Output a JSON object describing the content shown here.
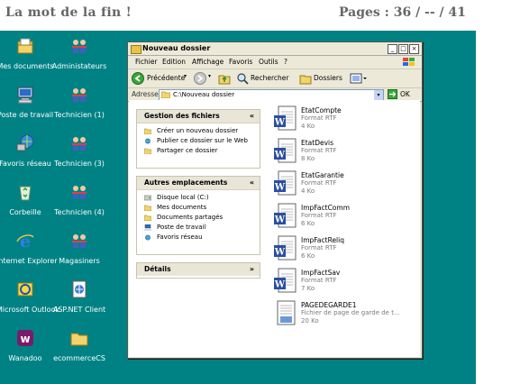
{
  "header": {
    "title": "La mot de la fin !",
    "pages": "Pages : 36 / -- / 41"
  },
  "desktop": {
    "background": "#008284",
    "icons": [
      {
        "label": "Mes documents",
        "icon": "my-documents-icon"
      },
      {
        "label": "Administateurs",
        "icon": "users-icon"
      },
      {
        "label": "Poste de travail",
        "icon": "my-computer-icon"
      },
      {
        "label": "Technicien (1)",
        "icon": "users-icon"
      },
      {
        "label": "Favoris réseau",
        "icon": "network-icon"
      },
      {
        "label": "Technicien (3)",
        "icon": "users-icon"
      },
      {
        "label": "Corbeille",
        "icon": "recycle-bin-icon"
      },
      {
        "label": "Technicien (4)",
        "icon": "users-icon"
      },
      {
        "label": "Internet Explorer",
        "icon": "internet-explorer-icon"
      },
      {
        "label": "Magasiners",
        "icon": "users-icon"
      },
      {
        "label": "Microsoft Outlook",
        "icon": "outlook-icon"
      },
      {
        "label": "ASP.NET Client",
        "icon": "aspnet-icon"
      },
      {
        "label": "Wanadoo",
        "icon": "wanadoo-icon"
      },
      {
        "label": "ecommerceCS",
        "icon": "folder-icon"
      }
    ]
  },
  "window": {
    "title": "Nouveau dossier",
    "menu": [
      "Fichier",
      "Edition",
      "Affichage",
      "Favoris",
      "Outils",
      "?"
    ],
    "toolbar": {
      "back": "Précédente",
      "search": "Rechercher",
      "folders": "Dossiers"
    },
    "address": {
      "label": "Adresse",
      "value": "C:\\Nouveau dossier",
      "go": "OK"
    },
    "tasks": {
      "file_tasks": {
        "title": "Gestion des fichiers",
        "items": [
          "Créer un nouveau dossier",
          "Publier ce dossier sur le Web",
          "Partager ce dossier"
        ]
      },
      "other_places": {
        "title": "Autres emplacements",
        "items": [
          "Disque local (C:)",
          "Mes documents",
          "Documents partagés",
          "Poste de travail",
          "Favoris réseau"
        ]
      },
      "details": {
        "title": "Détails"
      }
    },
    "files": [
      {
        "name": "EtatCompte",
        "type": "Format RTF",
        "size": "4 Ko",
        "icon": "word-doc-icon"
      },
      {
        "name": "EtatDevis",
        "type": "Format RTF",
        "size": "8 Ko",
        "icon": "word-doc-icon"
      },
      {
        "name": "EtatGarantie",
        "type": "Format RTF",
        "size": "4 Ko",
        "icon": "word-doc-icon"
      },
      {
        "name": "ImpFactComm",
        "type": "Format RTF",
        "size": "6 Ko",
        "icon": "word-doc-icon"
      },
      {
        "name": "ImpFactReliq",
        "type": "Format RTF",
        "size": "6 Ko",
        "icon": "word-doc-icon"
      },
      {
        "name": "ImpFactSav",
        "type": "Format RTF",
        "size": "7 Ko",
        "icon": "word-doc-icon"
      },
      {
        "name": "PAGEDEGARDE1",
        "type": "Fichier de page de garde de t...",
        "size": "20 Ko",
        "icon": "cover-page-icon"
      }
    ]
  }
}
